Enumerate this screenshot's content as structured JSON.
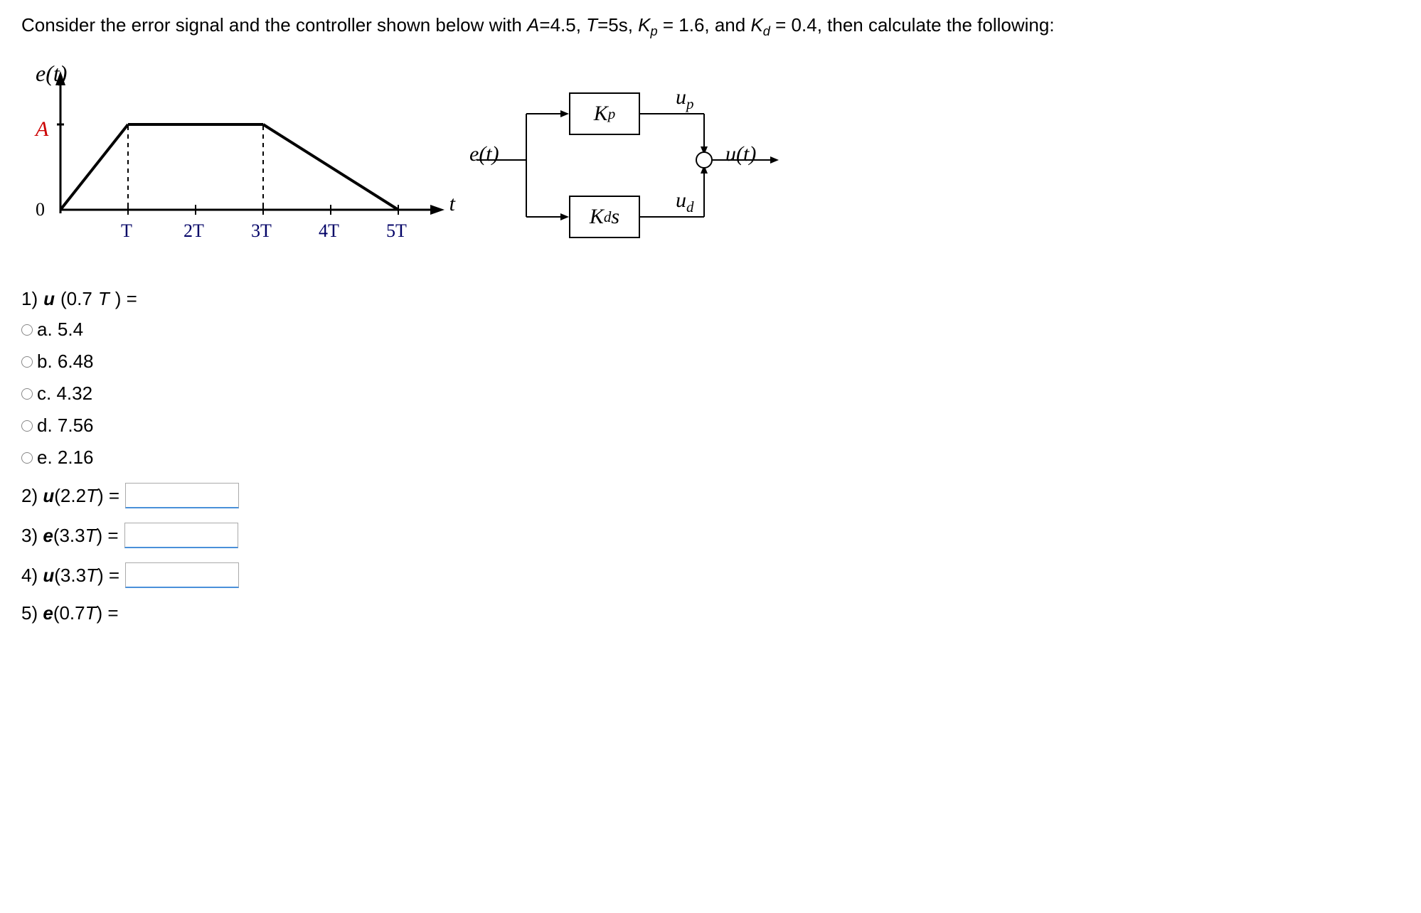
{
  "prompt": {
    "prefix": "Consider the error signal and the controller shown below with ",
    "A_label": "A",
    "A_val": "=4.5, ",
    "T_label": "T",
    "T_val": "=5s, ",
    "Kp_label_K": "K",
    "Kp_label_sub": "p",
    "Kp_val": " = 1.6, and ",
    "Kd_label_K": "K",
    "Kd_label_sub": "d",
    "Kd_val": " = 0.4, then calculate the following:"
  },
  "graph": {
    "y_label": "e(t)",
    "A_label": "A",
    "zero_label": "0",
    "t_label": "t",
    "ticks": [
      "T",
      "2T",
      "3T",
      "4T",
      "5T"
    ]
  },
  "block": {
    "input": "e(t)",
    "kp": "K",
    "kp_sub": "p",
    "kd": "K",
    "kd_sub": "d",
    "kd_s": "s",
    "up": "u",
    "up_sub": "p",
    "ud": "u",
    "ud_sub": "d",
    "output": "u(t)"
  },
  "questions": [
    {
      "label_num": "1) ",
      "label_var": "u",
      "label_arg": "(0.7",
      "label_T": "T",
      "label_close": ") =",
      "type": "mc",
      "options": [
        "a. 5.4",
        "b. 6.48",
        "c. 4.32",
        "d. 7.56",
        "e. 2.16"
      ]
    },
    {
      "label_num": "2) ",
      "label_var": "u",
      "label_arg": "(2.2",
      "label_T": "T",
      "label_close": ") =",
      "type": "input"
    },
    {
      "label_num": "3) ",
      "label_var": "e",
      "label_arg": "(3.3",
      "label_T": "T",
      "label_close": ") =",
      "type": "input"
    },
    {
      "label_num": "4) ",
      "label_var": "u",
      "label_arg": "(3.3",
      "label_T": "T",
      "label_close": ") =",
      "type": "input"
    },
    {
      "label_num": "5) ",
      "label_var": "e",
      "label_arg": "(0.7",
      "label_T": "T",
      "label_close": ") =",
      "type": "input"
    }
  ],
  "chart_data": {
    "type": "line",
    "title": "Error signal e(t)",
    "xlabel": "t",
    "ylabel": "e(t)",
    "x": [
      0,
      5,
      15,
      25
    ],
    "y": [
      0,
      4.5,
      4.5,
      0
    ],
    "x_ticks_labels": [
      "T",
      "2T",
      "3T",
      "4T",
      "5T"
    ],
    "x_ticks_values": [
      5,
      10,
      15,
      20,
      25
    ],
    "y_ticks_labels": [
      "0",
      "A"
    ],
    "y_ticks_values": [
      0,
      4.5
    ],
    "parameters": {
      "A": 4.5,
      "T": 5,
      "Kp": 1.6,
      "Kd": 0.4
    }
  }
}
